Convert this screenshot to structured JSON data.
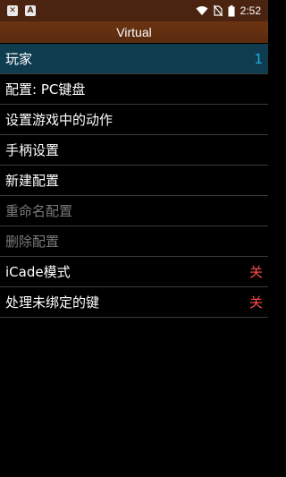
{
  "status_bar": {
    "time": "2:52",
    "left_icons": [
      "close-badge-icon",
      "a-badge-icon"
    ],
    "right_icons": [
      "wifi-icon",
      "no-sim-icon",
      "battery-icon"
    ]
  },
  "title": "Virtual",
  "menu": [
    {
      "label": "玩家",
      "value": "1",
      "selected": true,
      "disabled": false
    },
    {
      "label": "配置: PC键盘",
      "value": "",
      "selected": false,
      "disabled": false
    },
    {
      "label": "设置游戏中的动作",
      "value": "",
      "selected": false,
      "disabled": false
    },
    {
      "label": "手柄设置",
      "value": "",
      "selected": false,
      "disabled": false
    },
    {
      "label": "新建配置",
      "value": "",
      "selected": false,
      "disabled": false
    },
    {
      "label": "重命名配置",
      "value": "",
      "selected": false,
      "disabled": true
    },
    {
      "label": "删除配置",
      "value": "",
      "selected": false,
      "disabled": true
    },
    {
      "label": "iCade模式",
      "value": "关",
      "selected": false,
      "disabled": false
    },
    {
      "label": "处理未绑定的键",
      "value": "关",
      "selected": false,
      "disabled": false
    }
  ],
  "colors": {
    "status_bar_bg": "#4a2410",
    "title_bar_bg": "#6b3412",
    "selected_bg": "#103c50",
    "value_blue": "#1ab0e6",
    "value_red": "#ff4a4a"
  }
}
